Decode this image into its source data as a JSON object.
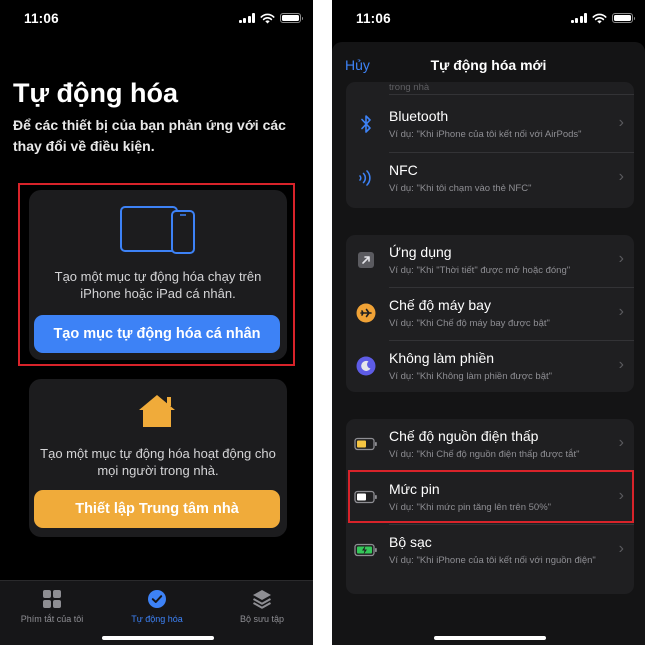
{
  "status": {
    "time": "11:06"
  },
  "left": {
    "title": "Tự động hóa",
    "description": "Để các thiết bị của bạn phản ứng với các thay đổi về điều kiện.",
    "personal_card": {
      "text": "Tạo một mục tự động hóa chạy trên iPhone hoặc iPad cá nhân.",
      "button": "Tạo mục tự động hóa cá nhân"
    },
    "home_card": {
      "text": "Tạo một mục tự động hóa hoạt động cho mọi người trong nhà.",
      "button": "Thiết lập Trung tâm nhà"
    },
    "tabs": [
      {
        "label": "Phím tắt của tôi"
      },
      {
        "label": "Tự động hóa"
      },
      {
        "label": "Bộ sưu tập"
      }
    ]
  },
  "right": {
    "nav": {
      "cancel": "Hủy",
      "title": "Tự động hóa mới"
    },
    "group1": {
      "partial_sub": "trong nhà",
      "rows": [
        {
          "title": "Bluetooth",
          "subtitle": "Ví dụ: \"Khi iPhone của tôi kết nối với AirPods\""
        },
        {
          "title": "NFC",
          "subtitle": "Ví dụ: \"Khi tôi chạm vào thẻ NFC\""
        }
      ]
    },
    "group2": {
      "rows": [
        {
          "title": "Ứng dụng",
          "subtitle": "Ví dụ: \"Khi \"Thời tiết\" được mở hoặc đóng\""
        },
        {
          "title": "Chế độ máy bay",
          "subtitle": "Ví dụ: \"Khi Chế độ máy bay được bật\""
        },
        {
          "title": "Không làm phiền",
          "subtitle": "Ví dụ: \"Khi Không làm phiền được bật\""
        }
      ]
    },
    "group3": {
      "rows": [
        {
          "title": "Chế độ nguồn điện thấp",
          "subtitle": "Ví dụ: \"Khi Chế độ nguồn điện thấp được tắt\""
        },
        {
          "title": "Mức pin",
          "subtitle": "Ví dụ: \"Khi mức pin tăng lên trên 50%\""
        },
        {
          "title": "Bộ sạc",
          "subtitle": "Ví dụ: \"Khi iPhone của tôi kết nối với nguồn điện\""
        }
      ]
    }
  },
  "colors": {
    "accent_blue": "#3d82f6",
    "home_orange": "#f0ab3a",
    "highlight_red": "#d8232a"
  }
}
